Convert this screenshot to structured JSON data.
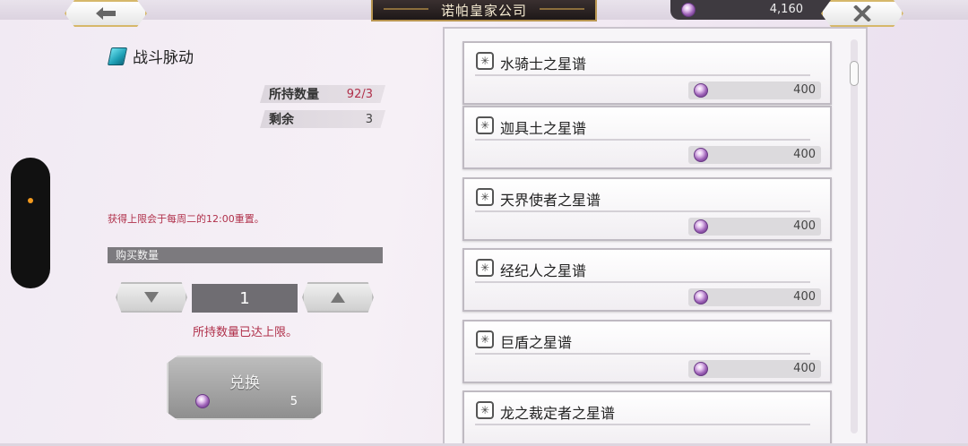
{
  "header": {
    "title": "诺帕皇家公司",
    "currency_amount": "4,160",
    "back_icon": "back-arrow-icon",
    "close_icon": "close-icon"
  },
  "item": {
    "name": "战斗脉动",
    "owned_label": "所持数量",
    "owned_value": "92/3",
    "remaining_label": "剩余",
    "remaining_value": "3",
    "reset_note": "获得上限会于每周二的12:00重置。"
  },
  "purchase": {
    "quantity_label": "购买数量",
    "quantity": "1",
    "limit_note": "所持数量已达上限。",
    "exchange_label": "兑换",
    "exchange_cost": "5"
  },
  "shop_list": [
    {
      "name": "水骑士之星谱",
      "price": "400"
    },
    {
      "name": "迦具土之星谱",
      "price": "400"
    },
    {
      "name": "天界使者之星谱",
      "price": "400"
    },
    {
      "name": "经纪人之星谱",
      "price": "400"
    },
    {
      "name": "巨盾之星谱",
      "price": "400"
    },
    {
      "name": "龙之裁定者之星谱",
      "price": ""
    }
  ],
  "colors": {
    "accent_red": "#b0304a",
    "gold_border": "#d6b86a",
    "title_plate": "#2a2222"
  }
}
